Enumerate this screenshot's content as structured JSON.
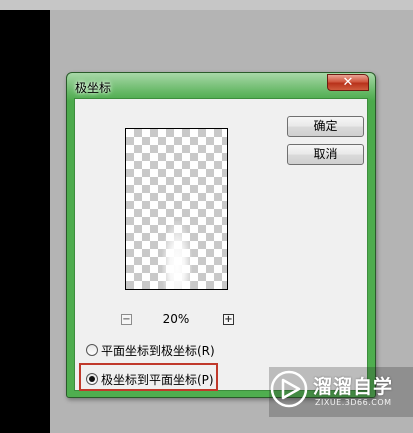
{
  "dialog": {
    "title": "极坐标",
    "close_glyph": "✕",
    "ok_label": "确定",
    "cancel_label": "取消",
    "zoom": {
      "minus": "−",
      "value": "20%",
      "plus": "+"
    },
    "options": [
      {
        "label": "平面坐标到极坐标(R)",
        "checked": false
      },
      {
        "label": "极坐标到平面坐标(P)",
        "checked": true
      }
    ]
  },
  "watermark": {
    "brand": "溜溜自学",
    "url": "ZIXUE.3D66.COM"
  },
  "colors": {
    "title_bar": "#4caa4c",
    "close_button": "#c8452b",
    "highlight": "#c0392b"
  }
}
